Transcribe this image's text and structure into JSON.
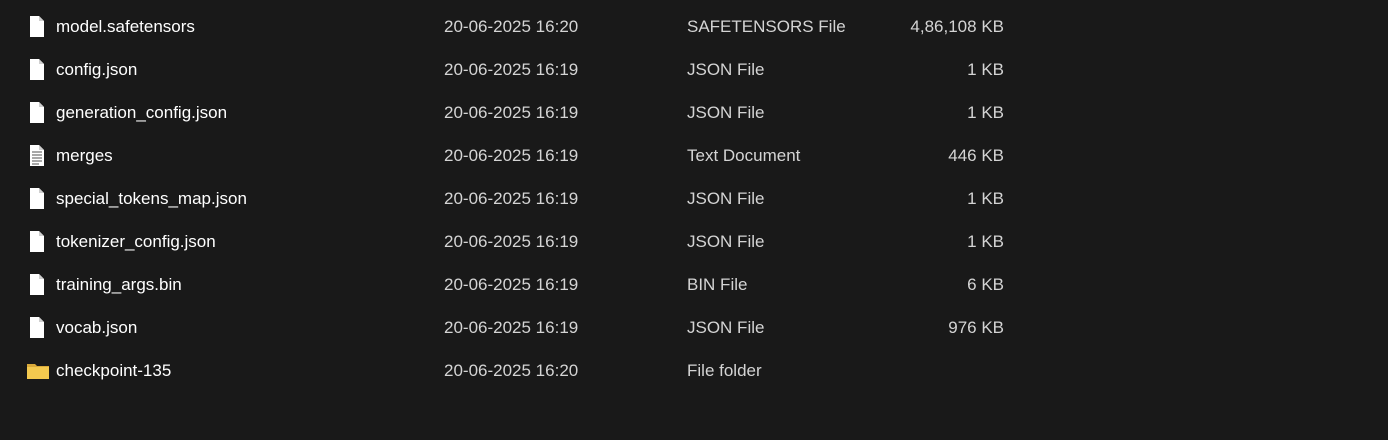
{
  "files": [
    {
      "name": "model.safetensors",
      "date": "20-06-2025 16:20",
      "type": "SAFETENSORS File",
      "size": "4,86,108 KB",
      "icon": "file-icon"
    },
    {
      "name": "config.json",
      "date": "20-06-2025 16:19",
      "type": "JSON File",
      "size": "1 KB",
      "icon": "file-icon"
    },
    {
      "name": "generation_config.json",
      "date": "20-06-2025 16:19",
      "type": "JSON File",
      "size": "1 KB",
      "icon": "file-icon"
    },
    {
      "name": "merges",
      "date": "20-06-2025 16:19",
      "type": "Text Document",
      "size": "446 KB",
      "icon": "text-document-icon"
    },
    {
      "name": "special_tokens_map.json",
      "date": "20-06-2025 16:19",
      "type": "JSON File",
      "size": "1 KB",
      "icon": "file-icon"
    },
    {
      "name": "tokenizer_config.json",
      "date": "20-06-2025 16:19",
      "type": "JSON File",
      "size": "1 KB",
      "icon": "file-icon"
    },
    {
      "name": "training_args.bin",
      "date": "20-06-2025 16:19",
      "type": "BIN File",
      "size": "6 KB",
      "icon": "file-icon"
    },
    {
      "name": "vocab.json",
      "date": "20-06-2025 16:19",
      "type": "JSON File",
      "size": "976 KB",
      "icon": "file-icon"
    },
    {
      "name": "checkpoint-135",
      "date": "20-06-2025 16:20",
      "type": "File folder",
      "size": "",
      "icon": "folder-icon"
    }
  ],
  "colors": {
    "background": "#191919",
    "folder": "#f0c44c",
    "file_icon": "#ffffff"
  }
}
